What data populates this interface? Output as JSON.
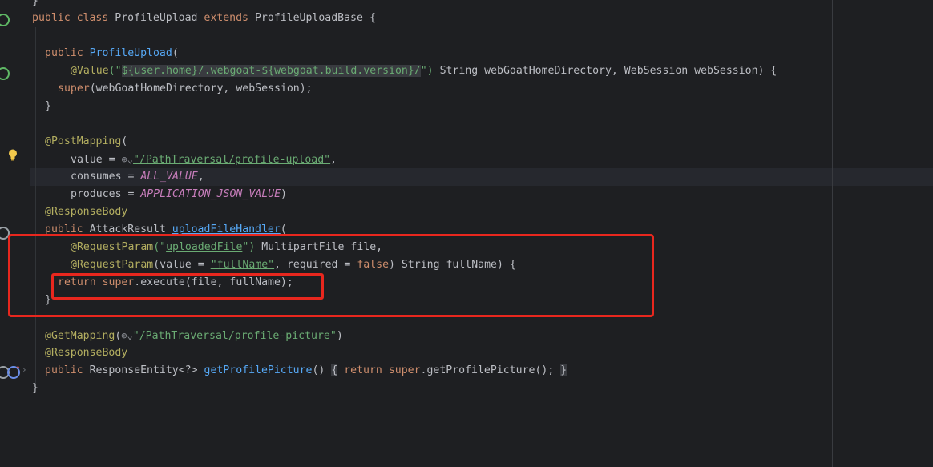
{
  "code": {
    "l0": "}",
    "l1": {
      "kw1": "public",
      "kw2": "class",
      "name": "ProfileUpload",
      "kw3": "extends",
      "base": "ProfileUploadBase",
      "brace": "{"
    },
    "l3": {
      "kw": "public",
      "fn": "ProfileUpload",
      "rest": "("
    },
    "l4": {
      "ann": "@Value",
      "q1": "(\"",
      "tmpl1": "${user.home}",
      "mid": "/.webgoat-",
      "tmpl2": "${webgoat.build.version}",
      "slash": "/",
      "q2": "\")",
      "rest": " String webGoatHomeDirectory, WebSession webSession) {"
    },
    "l5": {
      "kw": "super",
      "rest": "(webGoatHomeDirectory, webSession);"
    },
    "l6": "}",
    "l8": {
      "ann": "@PostMapping",
      "rest": "("
    },
    "l9": {
      "pre": "value = ",
      "globe": "⊕⌄",
      "str": "\"/PathTraversal/profile-upload\"",
      "post": ","
    },
    "l10": {
      "pre": "consumes = ",
      "const": "ALL_VALUE",
      "post": ","
    },
    "l11": {
      "pre": "produces = ",
      "const": "APPLICATION_JSON_VALUE",
      "post": ")"
    },
    "l12": {
      "ann": "@ResponseBody"
    },
    "l13": {
      "kw": "public",
      "type": " AttackResult ",
      "fn": "uploadFileHandler",
      "rest": "("
    },
    "l14": {
      "ann": "@RequestParam",
      "p1": "(\"",
      "str": "uploadedFile",
      "p2": "\")",
      "rest": " MultipartFile file,"
    },
    "l15": {
      "ann": "@RequestParam",
      "p1": "(value = ",
      "str": "\"fullName\"",
      "p2": ", required = ",
      "kw": "false",
      "rest": ") String fullName) {"
    },
    "l16": {
      "kw1": "return",
      "kw2": "super",
      "rest": ".execute(file, fullName);"
    },
    "l17": "}",
    "l19": {
      "ann": "@GetMapping",
      "p1": "(",
      "globe": "⊕⌄",
      "str": "\"/PathTraversal/profile-picture\"",
      "p2": ")"
    },
    "l20": {
      "ann": "@ResponseBody"
    },
    "l21": {
      "kw": "public",
      "type": " ResponseEntity<?> ",
      "fn": "getProfilePicture",
      "p": "()",
      "f1": "{",
      "kw2": "return",
      "kw3": "super",
      "call": ".getProfilePicture();",
      "f2": "}"
    },
    "l22": "}"
  },
  "colors": {
    "highlight_box": "#e8271e",
    "background": "#1e1f22"
  }
}
